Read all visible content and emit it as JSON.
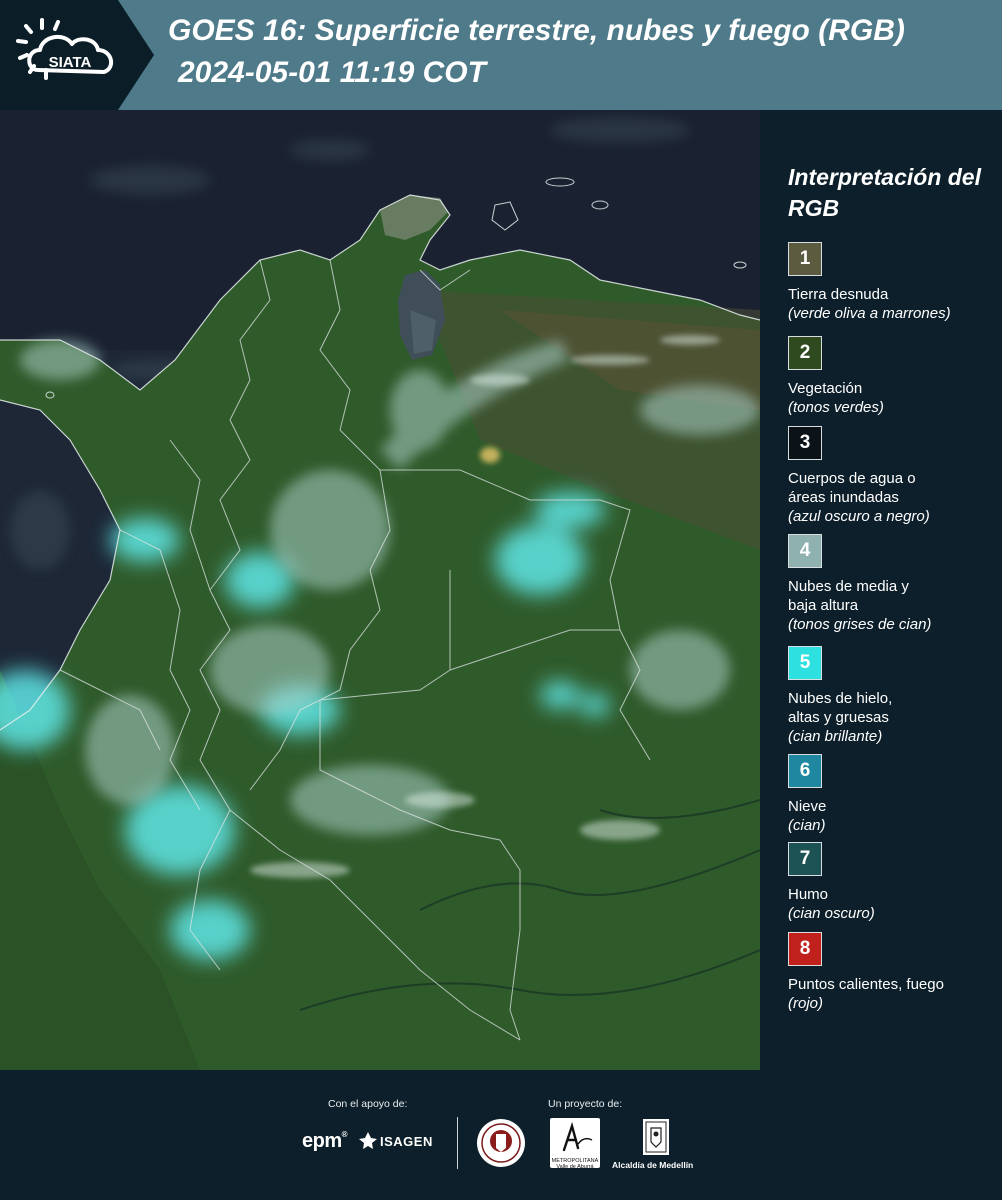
{
  "header": {
    "title_line1": "GOES 16: Superficie terrestre, nubes y fuego (RGB)",
    "title_line2": "2024-05-01 11:19 COT",
    "logo_text": "SIATA",
    "band_color": "#4e7a8a"
  },
  "legend": {
    "title": "Interpretación del RGB",
    "items": [
      {
        "number": "1",
        "label": "Tierra desnuda",
        "sub": "(verde oliva a marrones)",
        "color": "#5c5b40"
      },
      {
        "number": "2",
        "label": "Vegetación",
        "sub": "(tonos verdes)",
        "color": "#2f4a1f"
      },
      {
        "number": "3",
        "label": "Cuerpos de agua o áreas inundadas",
        "sub": "(azul oscuro a negro)",
        "color": "#0b1218"
      },
      {
        "number": "4",
        "label": "Nubes de media y baja altura",
        "sub": "(tonos grises de cian)",
        "color": "#8fb2b0"
      },
      {
        "number": "5",
        "label": "Nubes de hielo, altas y gruesas",
        "sub": "(cian brillante)",
        "color": "#2fe0e0"
      },
      {
        "number": "6",
        "label": "Nieve",
        "sub": "(cian)",
        "color": "#1f88a0"
      },
      {
        "number": "7",
        "label": "Humo",
        "sub": "(cian oscuro)",
        "color": "#1e5356"
      },
      {
        "number": "8",
        "label": "Puntos calientes, fuego",
        "sub": "(rojo)",
        "color": "#c0211d"
      }
    ]
  },
  "footer": {
    "support_caption": "Con el apoyo de:",
    "project_caption": "Un proyecto de:",
    "sponsor_epm": "epm",
    "sponsor_isagen": "ISAGEN",
    "partner_area_line1": "METROPOLITANA",
    "partner_area_line2": "Valle de Aburrá",
    "partner_alcaldia": "Alcaldía de Medellín"
  }
}
